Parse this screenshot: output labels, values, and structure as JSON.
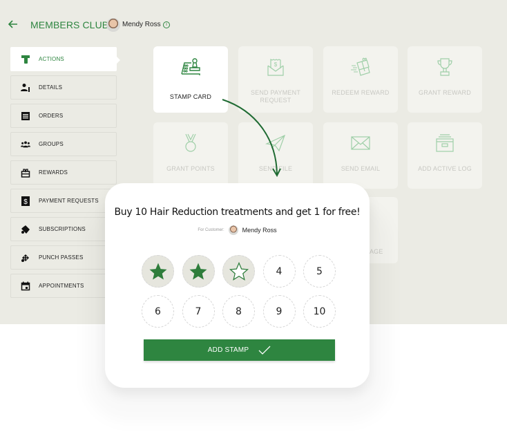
{
  "header": {
    "back_icon": "arrow-left-icon",
    "title": "MEMBERS CLUB",
    "member_name": "Mendy Ross",
    "info_icon": "info-icon"
  },
  "colors": {
    "accent": "#2e8540",
    "background": "#ebebe4",
    "tile_disabled": "#f3f3ee"
  },
  "sidebar": {
    "items": [
      {
        "label": "ACTIONS",
        "icon": "hand-coin-icon",
        "active": true
      },
      {
        "label": "DETAILS",
        "icon": "user-info-icon"
      },
      {
        "label": "ORDERS",
        "icon": "list-icon"
      },
      {
        "label": "GROUPS",
        "icon": "group-icon"
      },
      {
        "label": "REWARDS",
        "icon": "gift-box-icon"
      },
      {
        "label": "PAYMENT REQUESTS",
        "icon": "dollar-icon"
      },
      {
        "label": "SUBSCRIPTIONS",
        "icon": "tag-icon"
      },
      {
        "label": "PUNCH PASSES",
        "icon": "punch-pass-icon"
      },
      {
        "label": "APPOINTMENTS",
        "icon": "calendar-icon"
      }
    ]
  },
  "actions": {
    "tiles": [
      {
        "label": "STAMP CARD",
        "icon": "stamp-card-icon",
        "active": true
      },
      {
        "label": "SEND PAYMENT REQUEST",
        "icon": "payment-envelope-icon"
      },
      {
        "label": "REDEEM REWARD",
        "icon": "gift-icon"
      },
      {
        "label": "GRANT REWARD",
        "icon": "trophy-icon"
      },
      {
        "label": "GRANT POINTS",
        "icon": "medal-icon"
      },
      {
        "label": "SEND FILE",
        "icon": "paper-plane-icon"
      },
      {
        "label": "SEND EMAIL",
        "icon": "envelope-icon"
      },
      {
        "label": "ADD ACTIVE LOG",
        "icon": "archive-box-icon"
      },
      {
        "label": "PAGE",
        "icon": ""
      }
    ]
  },
  "stamp_card": {
    "title": "Buy 10 Hair Reduction treatments and get 1 for free!",
    "customer_label": "For Customer:",
    "customer_name": "Mendy Ross",
    "stamps": [
      {
        "label": "1",
        "state": "stamped"
      },
      {
        "label": "2",
        "state": "stamped"
      },
      {
        "label": "3",
        "state": "pending"
      },
      {
        "label": "4",
        "state": "empty"
      },
      {
        "label": "5",
        "state": "empty"
      },
      {
        "label": "6",
        "state": "empty"
      },
      {
        "label": "7",
        "state": "empty"
      },
      {
        "label": "8",
        "state": "empty"
      },
      {
        "label": "9",
        "state": "empty"
      },
      {
        "label": "10",
        "state": "empty"
      }
    ],
    "button_label": "ADD STAMP",
    "button_icon": "checkmark-icon"
  }
}
